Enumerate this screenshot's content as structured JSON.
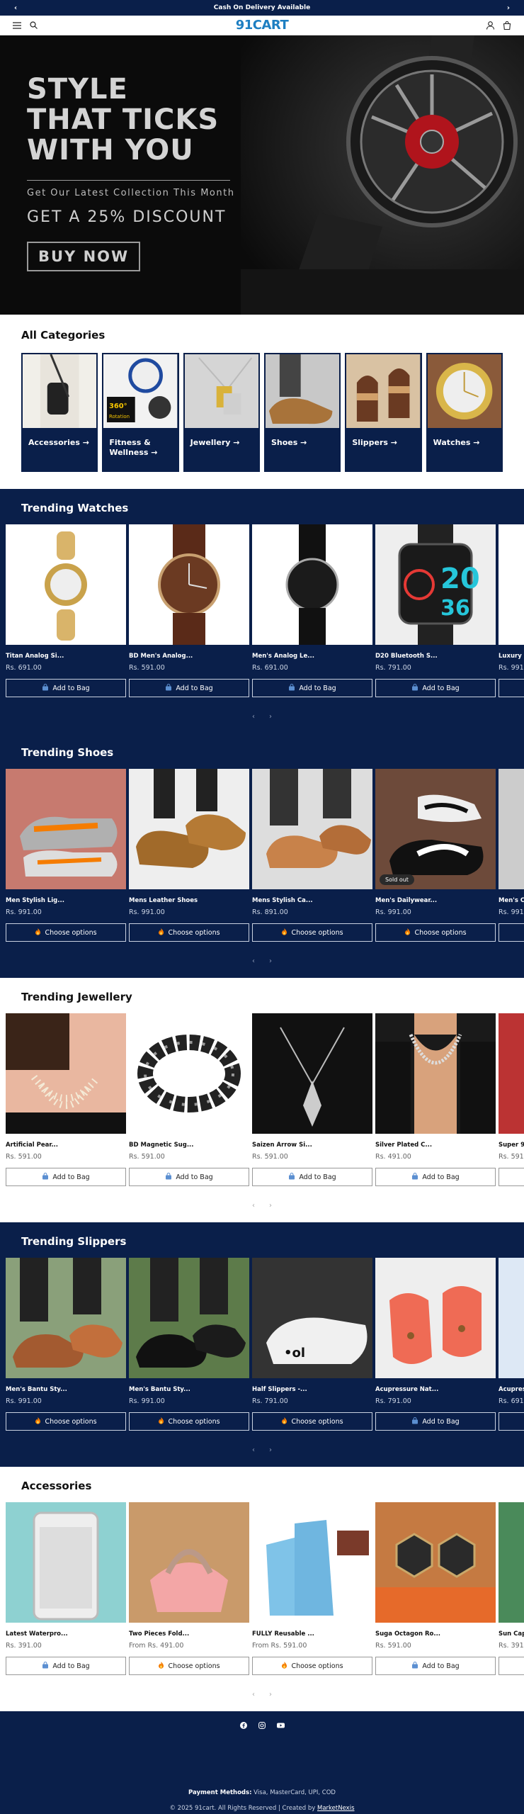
{
  "announcement": {
    "text": "Cash On Delivery Available",
    "prev": "‹",
    "next": "›"
  },
  "header": {
    "logo": "91CART"
  },
  "hero": {
    "title_lines": [
      "STYLE",
      "THAT TICKS",
      "WITH YOU"
    ],
    "subtitle": "Get Our Latest Collection This Month",
    "discount": "GET A 25% DISCOUNT",
    "button": "BUY NOW"
  },
  "categories": {
    "title": "All Categories",
    "items": [
      {
        "label": "Accessories →"
      },
      {
        "label": "Fitness & Wellness →"
      },
      {
        "label": "Jewellery →"
      },
      {
        "label": "Shoes →"
      },
      {
        "label": "Slippers →"
      },
      {
        "label": "Watches →"
      }
    ]
  },
  "sections": [
    {
      "title": "Trending Watches",
      "products": [
        {
          "name": "Titan Analog Si...",
          "price": "Rs. 691.00",
          "button": "Add to Bag",
          "btn_icon": "bag"
        },
        {
          "name": "BD Men's Analog...",
          "price": "Rs. 591.00",
          "button": "Add to Bag",
          "btn_icon": "bag"
        },
        {
          "name": "Men's Analog Le...",
          "price": "Rs. 691.00",
          "button": "Add to Bag",
          "btn_icon": "bag"
        },
        {
          "name": "D20 Bluetooth S...",
          "price": "Rs. 791.00",
          "button": "Add to Bag",
          "btn_icon": "bag"
        },
        {
          "name": "Luxury S",
          "price": "Rs. 991",
          "button": "",
          "btn_icon": ""
        }
      ]
    },
    {
      "title": "Trending Shoes",
      "products": [
        {
          "name": "Men Stylish Lig...",
          "price": "Rs. 991.00",
          "button": "Choose options",
          "btn_icon": "fire"
        },
        {
          "name": "Mens Leather Shoes",
          "price": "Rs. 991.00",
          "button": "Choose options",
          "btn_icon": "fire"
        },
        {
          "name": "Mens Stylish Ca...",
          "price": "Rs. 891.00",
          "button": "Choose options",
          "btn_icon": "fire"
        },
        {
          "name": "Men's Dailywear...",
          "price": "Rs. 991.00",
          "button": "Choose options",
          "btn_icon": "fire",
          "badge": "Sold out"
        },
        {
          "name": "Men's Co",
          "price": "Rs. 991",
          "button": "",
          "btn_icon": ""
        }
      ]
    },
    {
      "title": "Trending Jewellery",
      "products": [
        {
          "name": "Artificial Pear...",
          "price": "Rs. 591.00",
          "button": "Add to Bag",
          "btn_icon": "bag"
        },
        {
          "name": "BD Magnetic Sug...",
          "price": "Rs. 591.00",
          "button": "Add to Bag",
          "btn_icon": "bag"
        },
        {
          "name": "Saizen Arrow Si...",
          "price": "Rs. 591.00",
          "button": "Add to Bag",
          "btn_icon": "bag"
        },
        {
          "name": "Silver Plated C...",
          "price": "Rs. 491.00",
          "button": "Add to Bag",
          "btn_icon": "bag"
        },
        {
          "name": "Super 9 (",
          "price": "Rs. 591.",
          "button": "",
          "btn_icon": ""
        }
      ]
    },
    {
      "title": "Trending Slippers",
      "products": [
        {
          "name": "Men's Bantu Sty...",
          "price": "Rs. 991.00",
          "button": "Choose options",
          "btn_icon": "fire"
        },
        {
          "name": "Men's Bantu Sty...",
          "price": "Rs. 991.00",
          "button": "Choose options",
          "btn_icon": "fire"
        },
        {
          "name": "Half Slippers -...",
          "price": "Rs. 791.00",
          "button": "Choose options",
          "btn_icon": "fire"
        },
        {
          "name": "Acupressure Nat...",
          "price": "Rs. 791.00",
          "button": "Add to Bag",
          "btn_icon": "bag"
        },
        {
          "name": "Acupress",
          "price": "Rs. 691.",
          "button": "",
          "btn_icon": ""
        }
      ]
    },
    {
      "title": "Accessories",
      "products": [
        {
          "name": "Latest Waterpro...",
          "price": "Rs. 391.00",
          "button": "Add to Bag",
          "btn_icon": "bag"
        },
        {
          "name": "Two Pieces Fold...",
          "price": "From Rs. 491.00",
          "button": "Choose options",
          "btn_icon": "fire"
        },
        {
          "name": "FULLY Reusable ...",
          "price": "From Rs. 591.00",
          "button": "Choose options",
          "btn_icon": "fire"
        },
        {
          "name": "Suga Octagon Ro...",
          "price": "Rs. 591.00",
          "button": "Add to Bag",
          "btn_icon": "bag"
        },
        {
          "name": "Sun Cap",
          "price": "Rs. 391.",
          "button": "",
          "btn_icon": ""
        }
      ]
    }
  ],
  "pager": {
    "prev": "‹",
    "next": "›"
  },
  "footer": {
    "payment_label": "Payment Methods:",
    "payment_methods": "Visa, MasterCard, UPI, COD",
    "copyright": "© 2025 91cart. All Rights Reserved | Created by",
    "creator": "MarketNexis"
  },
  "colors": {
    "navy": "#0a1f4a",
    "logo_blue": "#1e7fc2"
  }
}
